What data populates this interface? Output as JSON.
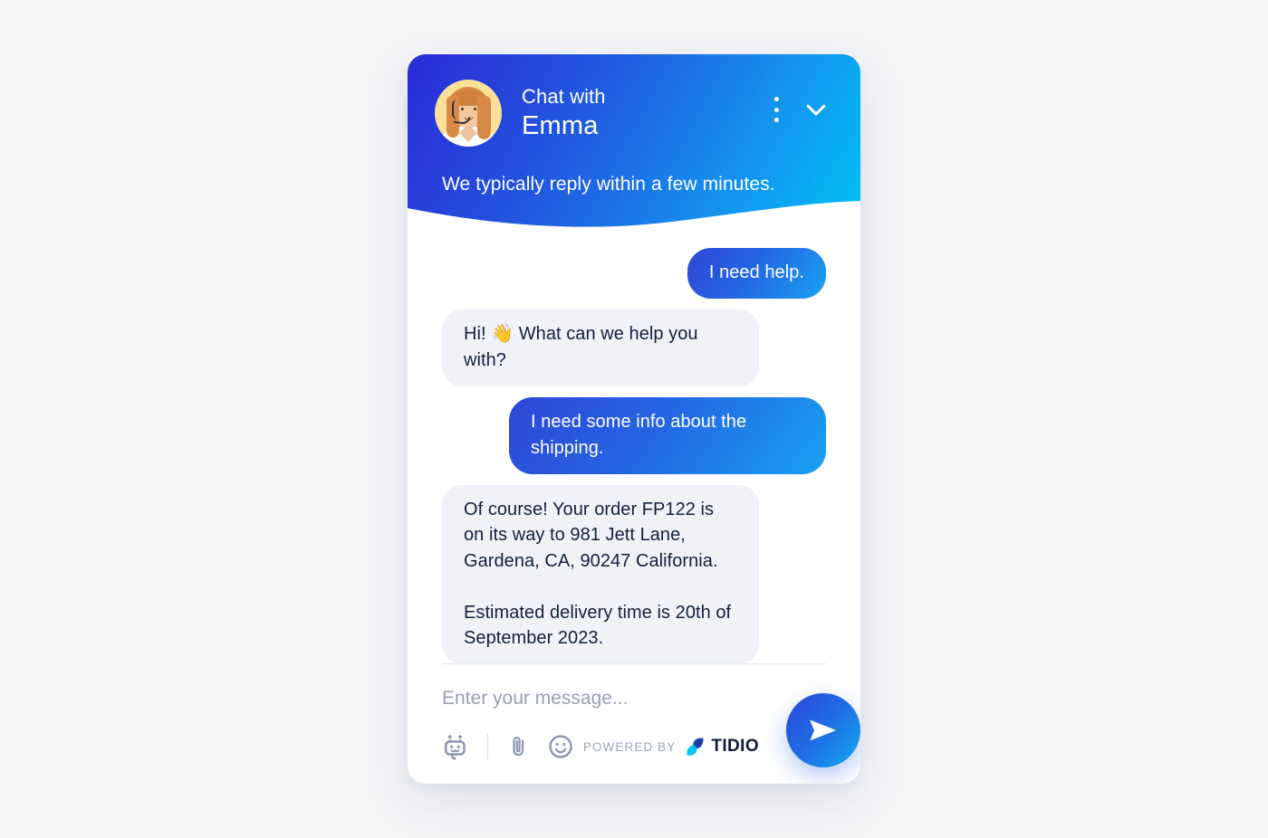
{
  "header": {
    "chat_with_label": "Chat with",
    "agent_name": "Emma",
    "reply_time": "We typically reply within a few minutes.",
    "avatar_name": "agent-avatar",
    "menu_icon": "dots-vertical-icon",
    "minimize_icon": "chevron-down-icon",
    "gradient_start": "#2a2ad8",
    "gradient_end": "#00c3f6"
  },
  "messages": [
    {
      "from": "user",
      "text": "I need help."
    },
    {
      "from": "agent",
      "text": "Hi! 👋 What can we help you with?"
    },
    {
      "from": "user",
      "text": "I need some info about the shipping."
    },
    {
      "from": "agent",
      "text": "Of course! Your order FP122 is on its way to 981 Jett Lane, Gardena, CA, 90247 California.\n\nEstimated delivery time is 20th of September 2023."
    }
  ],
  "composer": {
    "placeholder": "Enter your message...",
    "value": "",
    "bot_icon": "robot-icon",
    "attach_icon": "paperclip-icon",
    "emoji_icon": "smiley-icon",
    "send_icon": "send-plane-icon",
    "send_label": "Send"
  },
  "branding": {
    "powered_by": "POWERED BY",
    "brand": "TIDIO",
    "logo_icon": "tidio-logo-icon",
    "brand_color": "#101a35",
    "logo_accent": "#00c3f6"
  },
  "theme": {
    "page_background": "#f4f5f7",
    "user_bubble_start": "#2f47d6",
    "user_bubble_end": "#18a2f2",
    "agent_bubble_background": "#f0f2f7",
    "agent_bubble_text": "#14203f"
  }
}
